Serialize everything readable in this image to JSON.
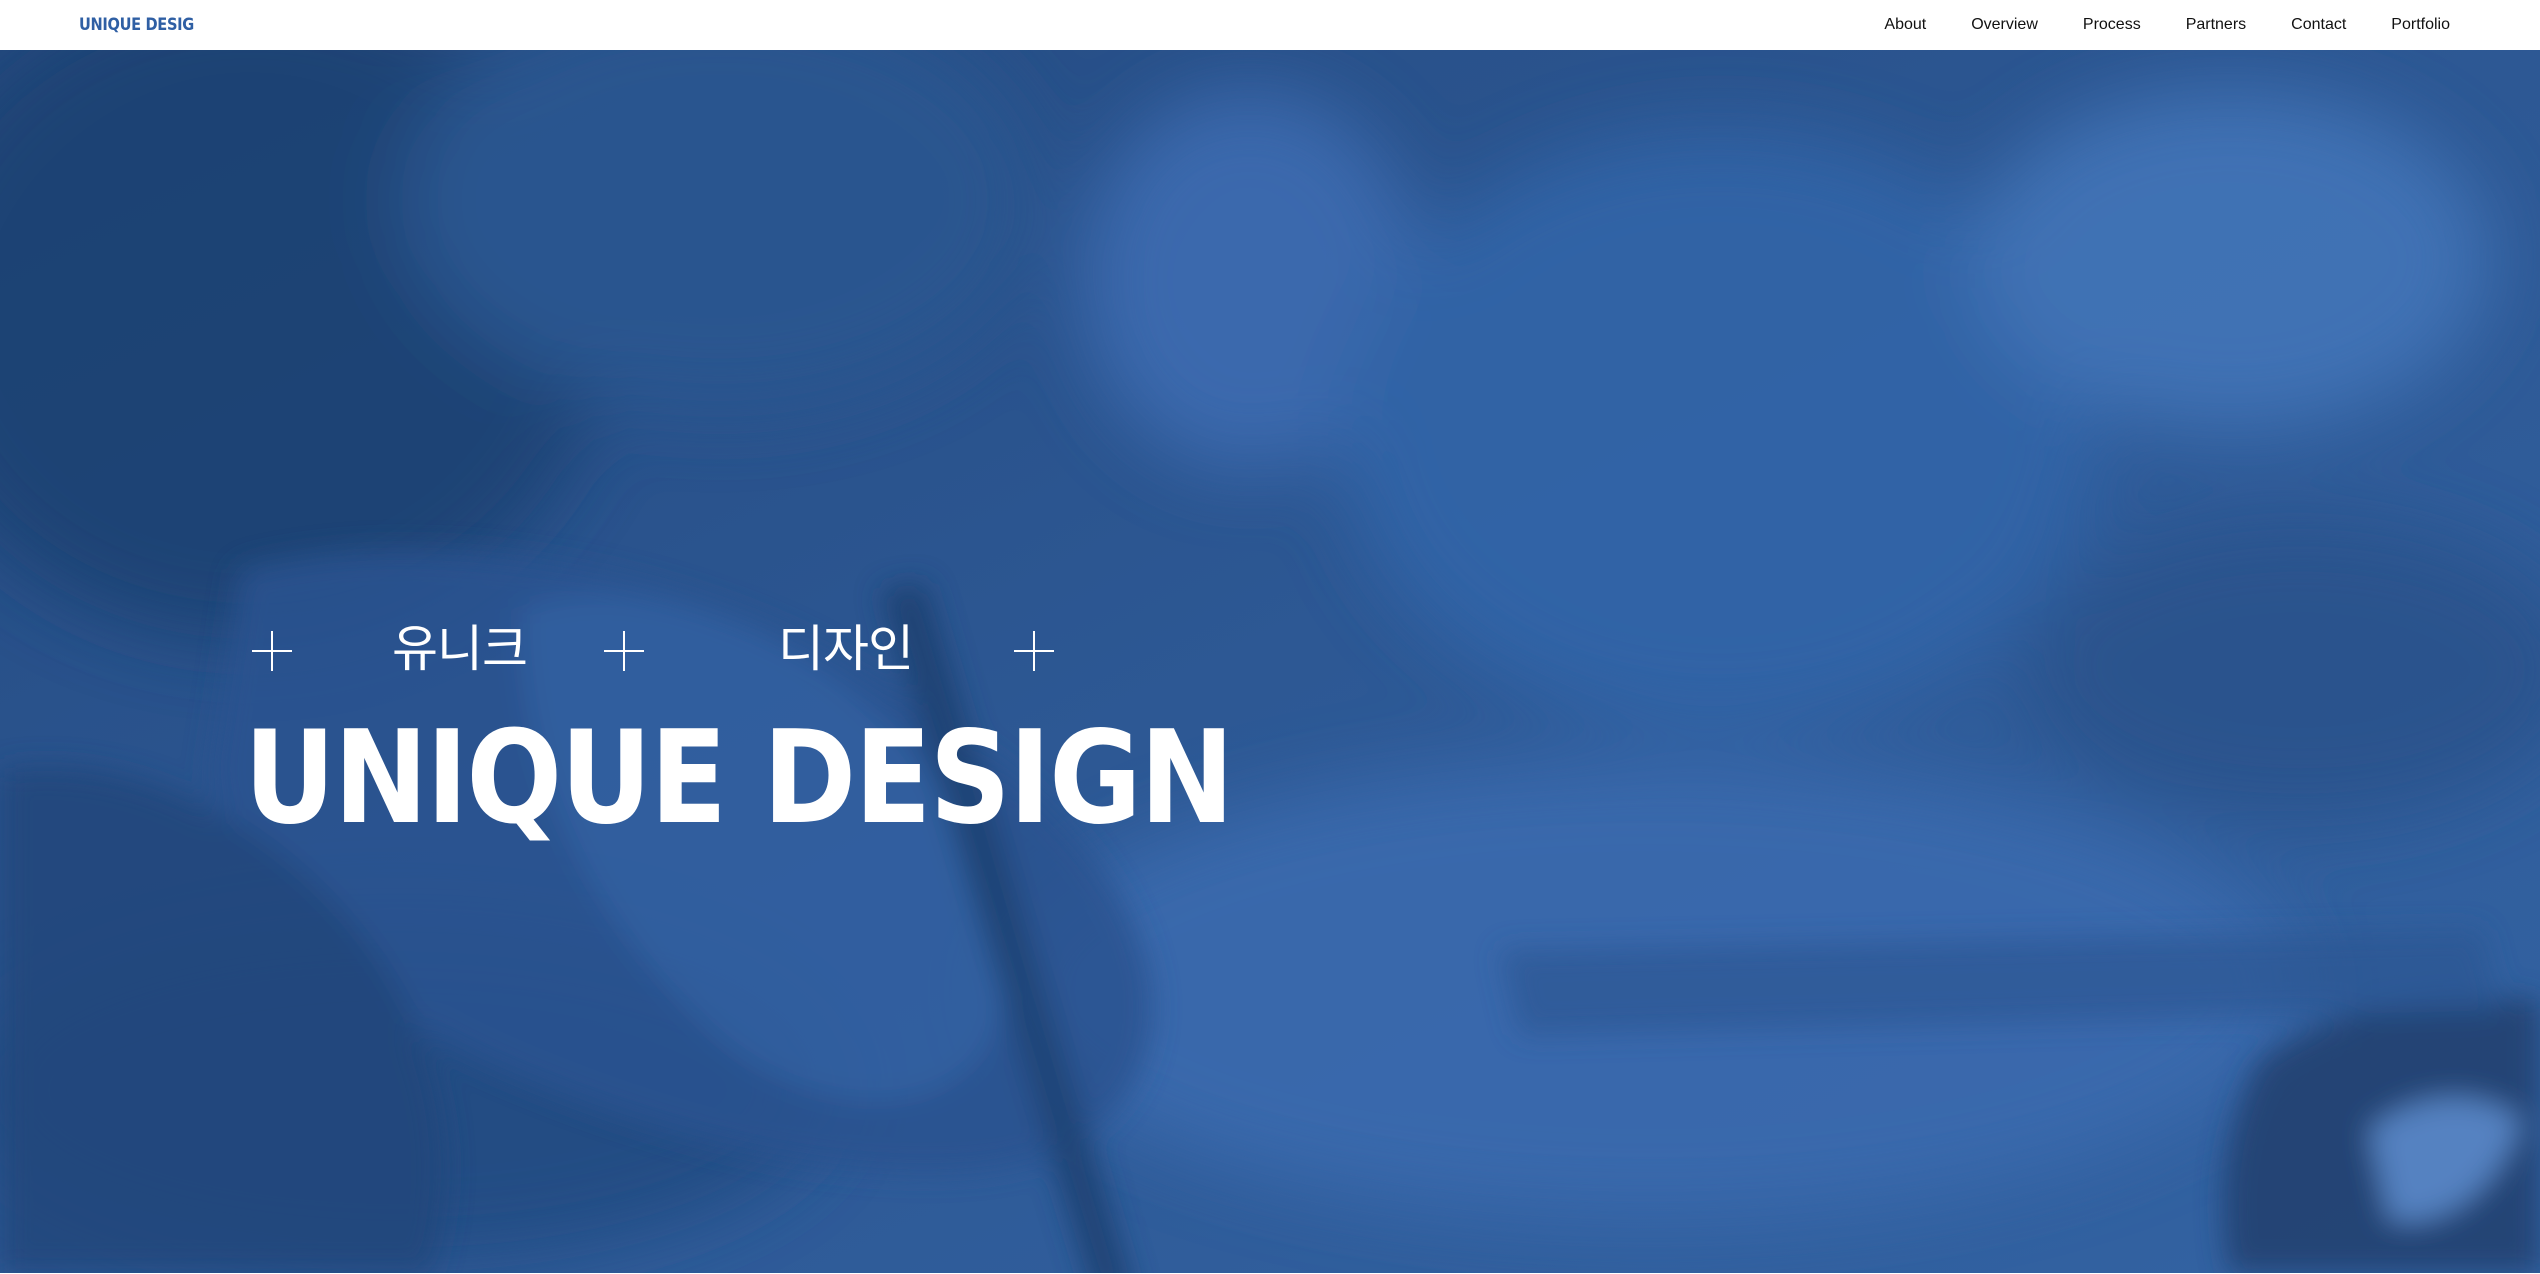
{
  "header": {
    "brand": "UNIQUE DESIG",
    "nav": [
      "About",
      "Overview",
      "Process",
      "Partners",
      "Contact",
      "Portfolio"
    ]
  },
  "hero": {
    "korean_left": "유니크",
    "korean_right": "디자인",
    "headline": "UNIQUE DESIGN",
    "overlay_color": "#2e5a97"
  },
  "icons": {
    "divider": "plus-icon"
  },
  "colors": {
    "brand": "#2f5fa4",
    "nav_text": "#111111",
    "hero_text": "#ffffff"
  }
}
